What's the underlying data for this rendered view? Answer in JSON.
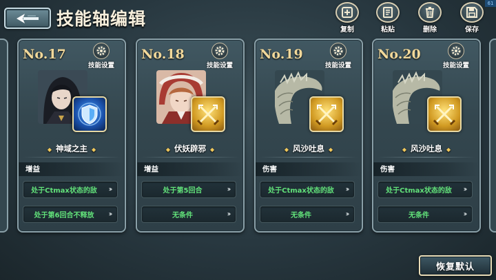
{
  "fps": "61",
  "header": {
    "title": "技能轴编辑"
  },
  "toolbar": [
    {
      "label": "复制",
      "icon": "copy-icon"
    },
    {
      "label": "粘贴",
      "icon": "paste-icon"
    },
    {
      "label": "删除",
      "icon": "trash-icon"
    },
    {
      "label": "保存",
      "icon": "save-icon"
    }
  ],
  "cards": [
    {
      "number": "No.17",
      "settings_label": "技能设置",
      "skill_name": "神域之主",
      "type_label": "增益",
      "portrait": "dark-haired-character-portrait",
      "skill_icon": "blue-shield-skill-icon",
      "conditions": [
        "处于Ctmax状态的敌",
        "处于第6回合不释放"
      ]
    },
    {
      "number": "No.18",
      "settings_label": "技能设置",
      "skill_name": "伏妖辟邪",
      "type_label": "增益",
      "portrait": "red-hood-girl-portrait",
      "skill_icon": "crossed-swords-skill-icon",
      "conditions": [
        "处于第5回合",
        "无条件"
      ]
    },
    {
      "number": "No.19",
      "settings_label": "技能设置",
      "skill_name": "风沙吐息",
      "type_label": "伤害",
      "portrait": "dragon-portrait",
      "skill_icon": "crossed-swords-skill-icon",
      "conditions": [
        "处于Ctmax状态的敌",
        "无条件"
      ]
    },
    {
      "number": "No.20",
      "settings_label": "技能设置",
      "skill_name": "风沙吐息",
      "type_label": "伤害",
      "portrait": "dragon-portrait",
      "skill_icon": "crossed-swords-skill-icon",
      "conditions": [
        "处于Ctmax状态的敌",
        "无条件"
      ]
    }
  ],
  "footer": {
    "restore_label": "恢复默认"
  },
  "colors": {
    "condition_text": "#62e27a",
    "card_number": "#f1d89a",
    "panel": "#34474f"
  }
}
